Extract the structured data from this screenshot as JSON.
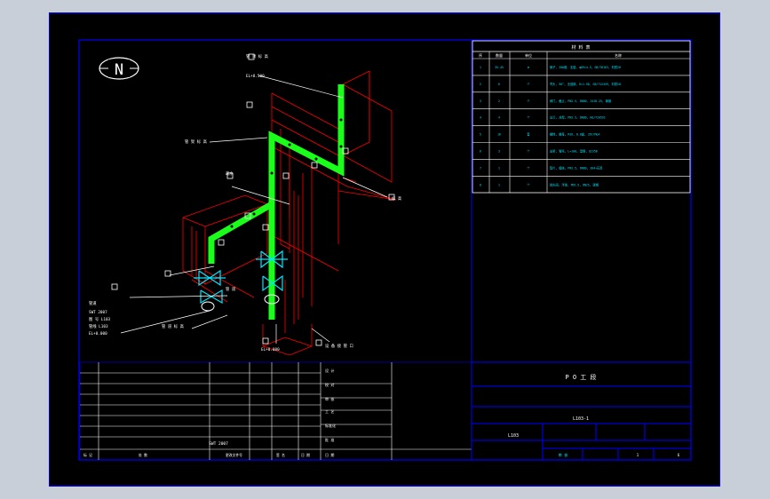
{
  "north_label": "N",
  "bom": {
    "title": "材 料 表",
    "headers": [
      "序",
      "数量",
      "单位",
      "名称"
    ],
    "rows": [
      {
        "no": "1",
        "qty": "35.45",
        "unit": "m",
        "desc": "管子, 20#钢, 无缝, φ89×4.5, GB/T8163, 材质20"
      },
      {
        "no": "2",
        "qty": "6",
        "unit": "个",
        "desc": "弯头, 90°, 无缝钢, R=1.5D, GB/T12459, 材质20"
      },
      {
        "no": "3",
        "qty": "2",
        "unit": "个",
        "desc": "阀门, 截止, PN2.5, DN80, J41H-25, 铸钢"
      },
      {
        "no": "4",
        "qty": "4",
        "unit": "个",
        "desc": "法兰, 对焊, PN2.5, DN80, HG/T20592"
      },
      {
        "no": "5",
        "qty": "16",
        "unit": "套",
        "desc": "螺栓, 螺母, M16, 8.8级, 35CrMoA"
      },
      {
        "no": "6",
        "qty": "3",
        "unit": "个",
        "desc": "支架, 管托, L=100, 型钢, Q235B"
      },
      {
        "no": "7",
        "qty": "1",
        "unit": "个",
        "desc": "垫片, 缠绕, PN2.5, DN80, 304+石墨"
      },
      {
        "no": "8",
        "qty": "1",
        "unit": "个",
        "desc": "疏水阀, 浮球, PN2.5, DN25, 碳钢"
      }
    ]
  },
  "title_block": {
    "project": "P O 工 段",
    "drawing_no": "L103-1",
    "line_no": "L103",
    "scale": "1",
    "sheet": "6",
    "approve_col": "审 核"
  },
  "callouts": {
    "top_elev": "管 顶 标 高",
    "top_elev_val": "EL+8.500",
    "left_tag": "管 架 标 高",
    "right_tag": "标 高",
    "steam_trap": "疏水",
    "mid_left": "管 道",
    "bot_left": "管 道 标 高",
    "bottom_tag": "EL+0.000",
    "bottom_right": "设 备 接 管 口"
  },
  "info_block": {
    "l1": "管道",
    "l2": "SWT 2007",
    "l3": "图 号 L103",
    "l4": "管线 L103",
    "l5": "EL+0.000"
  },
  "revision_footer": [
    "标 记",
    "处 数",
    "更改文件号",
    "签 名",
    "日 期"
  ],
  "sign_rows": [
    "设 计",
    "校 对",
    "审 核",
    "工 艺",
    "标准化",
    "批 准",
    "日 期"
  ],
  "colors": {
    "frame": "#0000ff",
    "pipe": "#1aff1a",
    "grid": "#ff0000",
    "annot": "#ffffff",
    "table_text": "#00e5ff"
  }
}
